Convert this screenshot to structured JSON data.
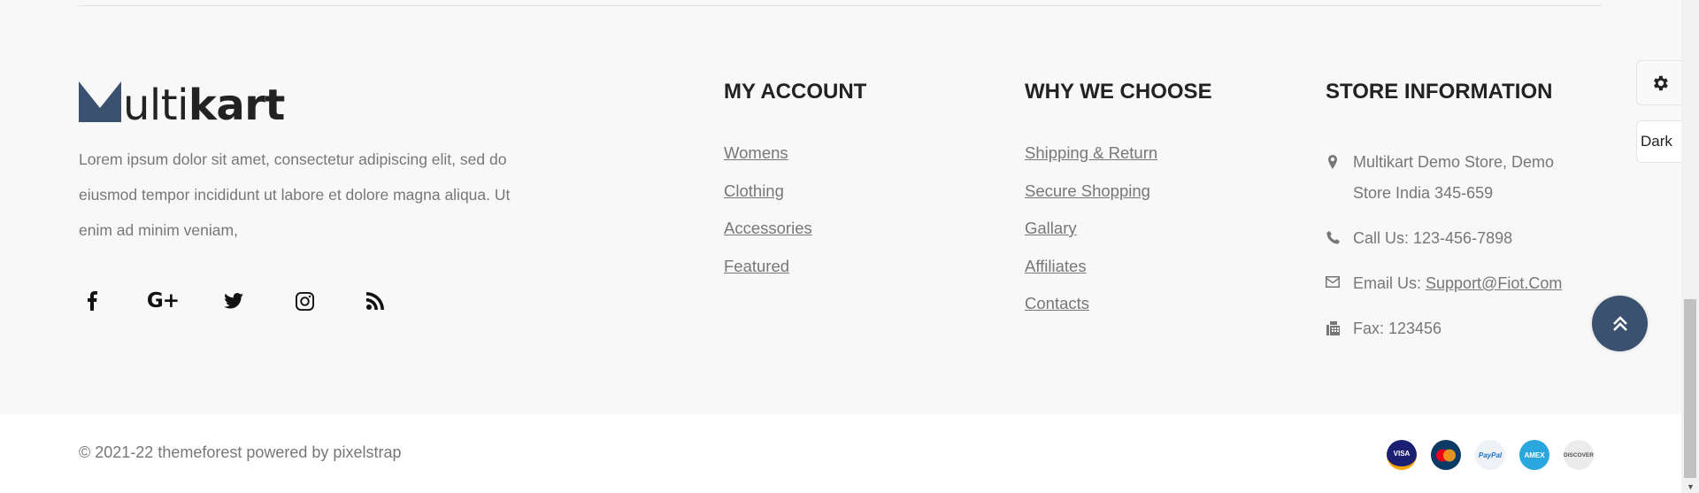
{
  "brand": {
    "logo_text_light": "ulti",
    "logo_text_bold": "kart",
    "logo_color": "#3a5170",
    "description": "Lorem ipsum dolor sit amet, consectetur adipiscing elit, sed do eiusmod tempor incididunt ut labore et dolore magna aliqua. Ut enim ad minim veniam,"
  },
  "social": [
    {
      "icon": "facebook-icon"
    },
    {
      "icon": "google-plus-icon",
      "glyph": "G+"
    },
    {
      "icon": "twitter-icon"
    },
    {
      "icon": "instagram-icon"
    },
    {
      "icon": "rss-icon"
    }
  ],
  "my_account": {
    "title": "MY ACCOUNT",
    "links": [
      "Womens",
      "Clothing",
      "Accessories",
      "Featured"
    ]
  },
  "why_we_choose": {
    "title": "WHY WE CHOOSE",
    "links": [
      "Shipping & Return",
      "Secure Shopping",
      "Gallary",
      "Affiliates",
      "Contacts"
    ]
  },
  "store_info": {
    "title": "STORE INFORMATION",
    "address": "Multikart Demo Store, Demo Store India 345-659",
    "call": "Call Us: 123-456-7898",
    "email_label": "Email Us: ",
    "email": "Support@Fiot.Com",
    "fax": "Fax: 123456"
  },
  "bottom": {
    "copyright": "© 2021-22 themeforest powered by pixelstrap",
    "payments": [
      {
        "icon": "visa-icon",
        "label": "VISA"
      },
      {
        "icon": "mastercard-icon",
        "label": "MasterCard"
      },
      {
        "icon": "paypal-icon",
        "label": "PayPal"
      },
      {
        "icon": "amex-icon",
        "label": "AMEX"
      },
      {
        "icon": "discover-icon",
        "label": "DISCOVER"
      }
    ]
  },
  "side_tools": {
    "settings_icon": "gear-icon",
    "dark_label": "Dark",
    "back_to_top_icon": "double-chevron-up-icon"
  },
  "colors": {
    "accent": "#3a5170",
    "footer_bg": "#f8f8f8",
    "heading": "#222222",
    "text": "#777777"
  }
}
